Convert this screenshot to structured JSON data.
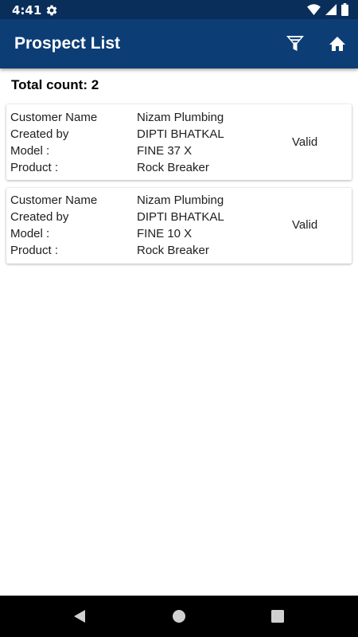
{
  "status_bar": {
    "time": "4:41",
    "icons": [
      "settings-gear-icon",
      "wifi-icon",
      "cell-signal-icon",
      "battery-icon"
    ]
  },
  "app_bar": {
    "title": "Prospect List",
    "actions": [
      "filter-icon",
      "home-icon"
    ],
    "background": "#0d3d75"
  },
  "summary": {
    "total_label": "Total count:",
    "total_value": "2"
  },
  "prospects": [
    {
      "customer_label": "Customer Name",
      "customer": "Nizam Plumbing",
      "created_label": "Created by",
      "created_by": "DIPTI BHATKAL",
      "model_label": "Model :",
      "model": "FINE 37 X",
      "product_label": "Product :",
      "product": "Rock Breaker",
      "status": "Valid"
    },
    {
      "customer_label": "Customer Name",
      "customer": "Nizam Plumbing",
      "created_label": "Created by",
      "created_by": "DIPTI BHATKAL",
      "model_label": "Model :",
      "model": "FINE 10 X",
      "product_label": "Product :",
      "product": "Rock Breaker",
      "status": "Valid"
    }
  ],
  "nav_bar": {
    "buttons": [
      "back-icon",
      "home-circle-icon",
      "recents-icon"
    ]
  }
}
